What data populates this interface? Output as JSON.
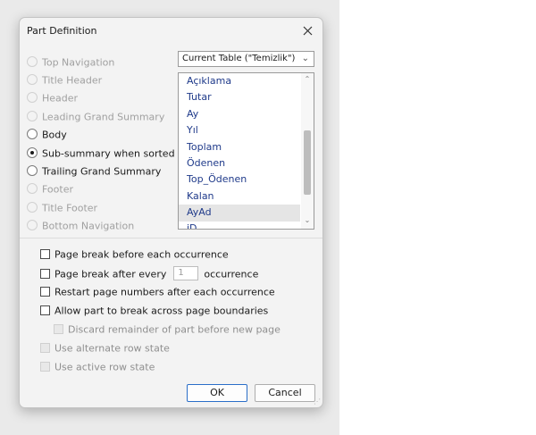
{
  "dialog": {
    "title": "Part Definition"
  },
  "part_types": [
    {
      "label": "Top Navigation",
      "enabled": false,
      "checked": false
    },
    {
      "label": "Title Header",
      "enabled": false,
      "checked": false
    },
    {
      "label": "Header",
      "enabled": false,
      "checked": false
    },
    {
      "label": "Leading Grand Summary",
      "enabled": false,
      "checked": false
    },
    {
      "label": "Body",
      "enabled": true,
      "checked": false
    },
    {
      "label": "Sub-summary when sorted by",
      "enabled": true,
      "checked": true
    },
    {
      "label": "Trailing Grand Summary",
      "enabled": true,
      "checked": false
    },
    {
      "label": "Footer",
      "enabled": false,
      "checked": false
    },
    {
      "label": "Title Footer",
      "enabled": false,
      "checked": false
    },
    {
      "label": "Bottom Navigation",
      "enabled": false,
      "checked": false
    }
  ],
  "table_select": {
    "value": "Current Table (\"Temizlik\")"
  },
  "fields": {
    "items": [
      "Açıklama",
      "Tutar",
      "Ay",
      "Yıl",
      "Toplam",
      "Ödenen",
      "Top_Ödenen",
      "Kalan",
      "AyAd",
      "iD"
    ],
    "selected": "AyAd"
  },
  "options": {
    "page_break_before": "Page break before each occurrence",
    "page_break_after": "Page break after every",
    "page_break_after_count": "1",
    "page_break_after_suffix": "occurrence",
    "restart_page_numbers": "Restart page numbers after each occurrence",
    "allow_break": "Allow part to break across page boundaries",
    "discard_remainder": "Discard remainder of part before new page",
    "alternate_row_state": "Use alternate row state",
    "active_row_state": "Use active row state"
  },
  "buttons": {
    "ok": "OK",
    "cancel": "Cancel"
  },
  "colors": {
    "accent": "#2a6ec8",
    "list_text": "#1f3a8a"
  }
}
